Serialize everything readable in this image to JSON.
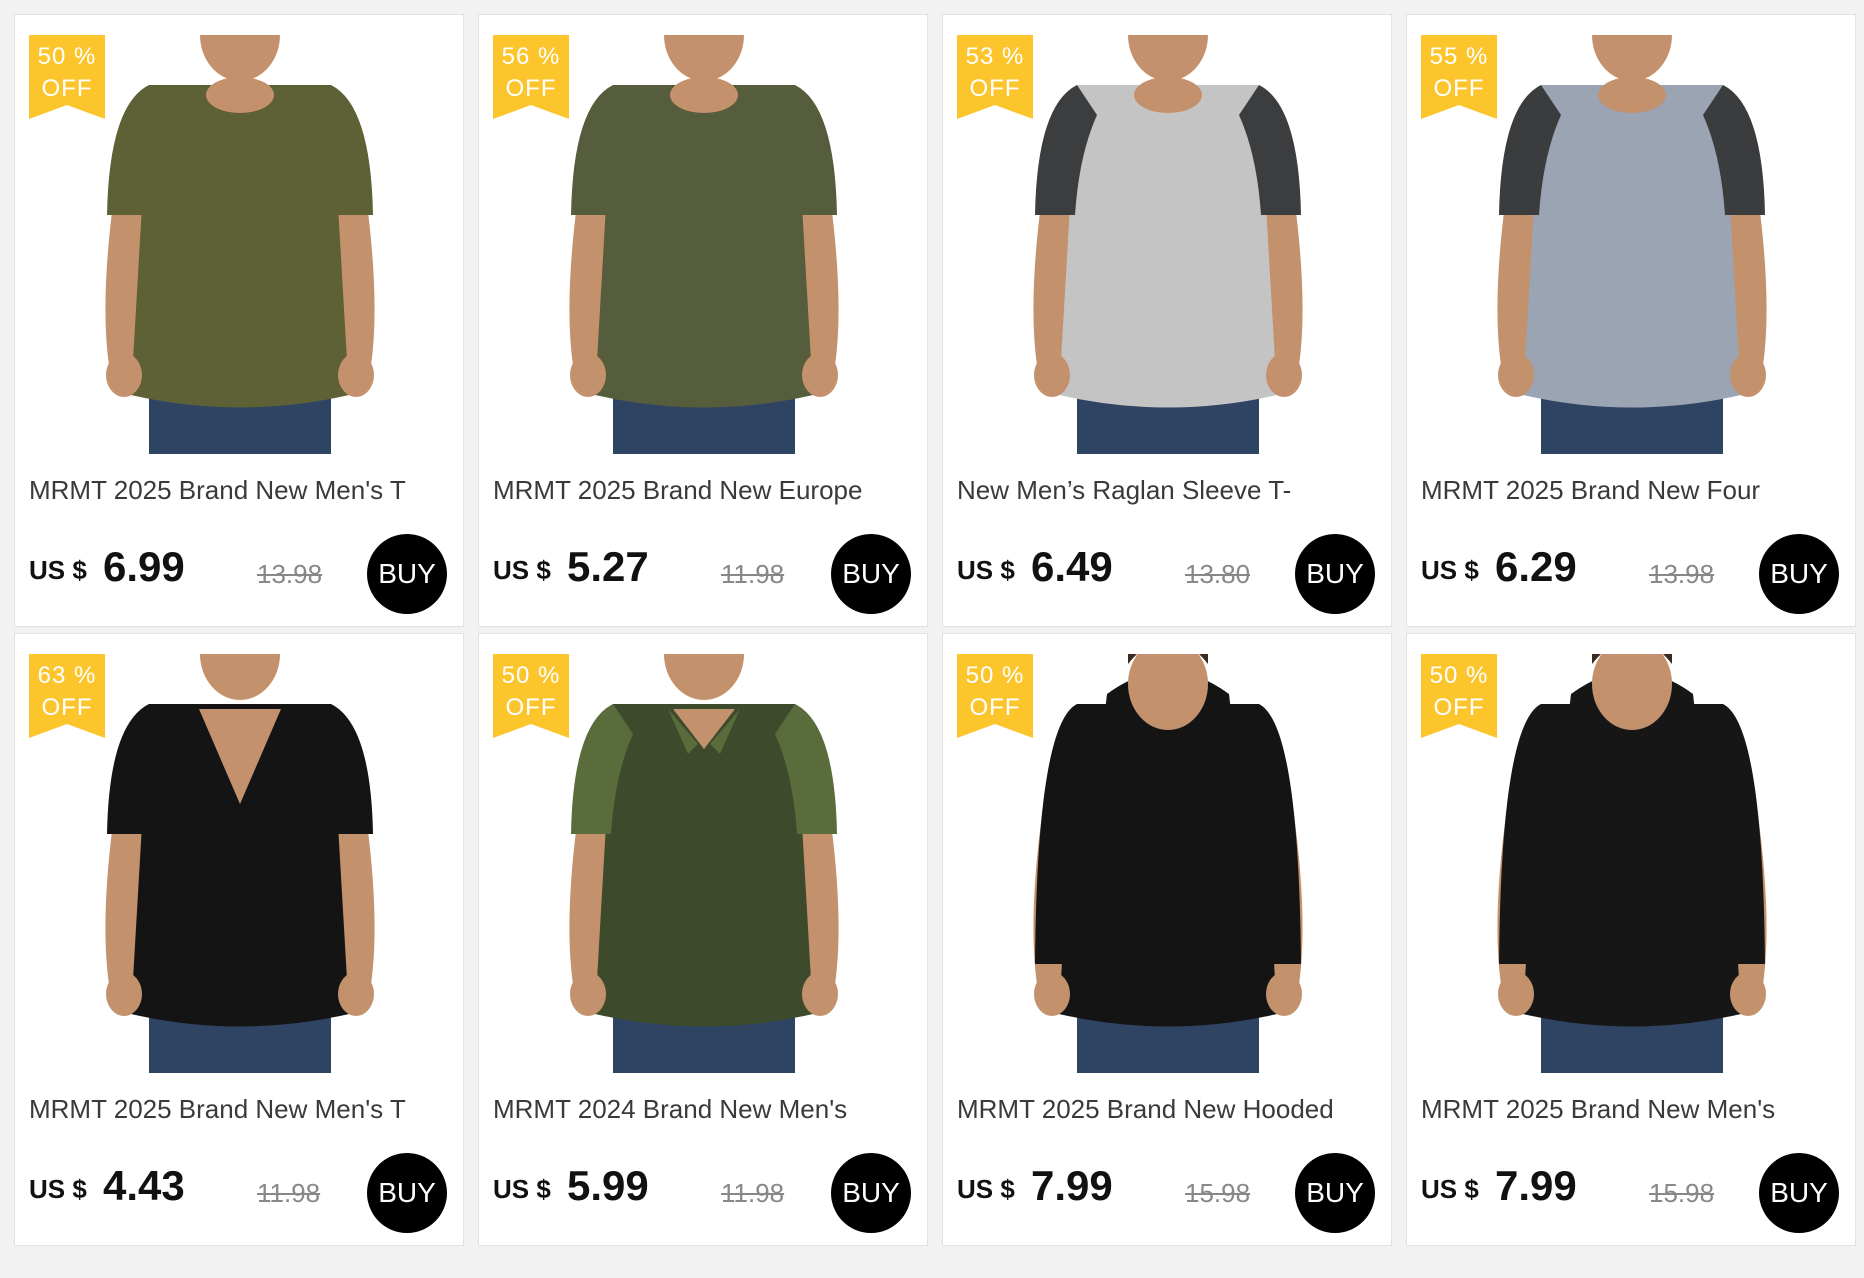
{
  "products": [
    {
      "discount": "50 %",
      "off": "OFF",
      "title": "MRMT 2025 Brand New Men's T",
      "currency": "US $",
      "price": "6.99",
      "old_price": "13.98",
      "buy": "BUY",
      "shirt_color": "#5e6136",
      "sleeve_color": "#5e6136",
      "style": "tee"
    },
    {
      "discount": "56 %",
      "off": "OFF",
      "title": "MRMT 2025 Brand New Europe",
      "currency": "US $",
      "price": "5.27",
      "old_price": "11.98",
      "buy": "BUY",
      "shirt_color": "#565d3c",
      "sleeve_color": "#565d3c",
      "style": "tee"
    },
    {
      "discount": "53 %",
      "off": "OFF",
      "title": "New Men’s Raglan Sleeve T-",
      "currency": "US $",
      "price": "6.49",
      "old_price": "13.80",
      "buy": "BUY",
      "shirt_color": "#c4c4c4",
      "sleeve_color": "#3b3d3f",
      "style": "raglan"
    },
    {
      "discount": "55 %",
      "off": "OFF",
      "title": "MRMT 2025 Brand New Four",
      "currency": "US $",
      "price": "6.29",
      "old_price": "13.98",
      "buy": "BUY",
      "shirt_color": "#9aa4b3",
      "sleeve_color": "#3a3c3e",
      "style": "raglan"
    },
    {
      "discount": "63 %",
      "off": "OFF",
      "title": "MRMT 2025 Brand New Men's T",
      "currency": "US $",
      "price": "4.43",
      "old_price": "11.98",
      "buy": "BUY",
      "shirt_color": "#141414",
      "sleeve_color": "#141414",
      "style": "vneck"
    },
    {
      "discount": "50 %",
      "off": "OFF",
      "title": "MRMT 2024 Brand New Men's",
      "currency": "US $",
      "price": "5.99",
      "old_price": "11.98",
      "buy": "BUY",
      "shirt_color": "#3d4a2c",
      "sleeve_color": "#5a6b3c",
      "style": "polo"
    },
    {
      "discount": "50 %",
      "off": "OFF",
      "title": "MRMT 2025 Brand New Hooded",
      "currency": "US $",
      "price": "7.99",
      "old_price": "15.98",
      "buy": "BUY",
      "shirt_color": "#141414",
      "sleeve_color": "#141414",
      "style": "hoodie"
    },
    {
      "discount": "50 %",
      "off": "OFF",
      "title": "MRMT 2025 Brand New Men's",
      "currency": "US $",
      "price": "7.99",
      "old_price": "15.98",
      "buy": "BUY",
      "shirt_color": "#161616",
      "sleeve_color": "#161616",
      "style": "hoodie"
    }
  ],
  "colors": {
    "badge": "#fcc52c",
    "buy_bg": "#000000",
    "skin": "#c4916d",
    "jeans": "#2f4463",
    "hair": "#3a2a20"
  }
}
